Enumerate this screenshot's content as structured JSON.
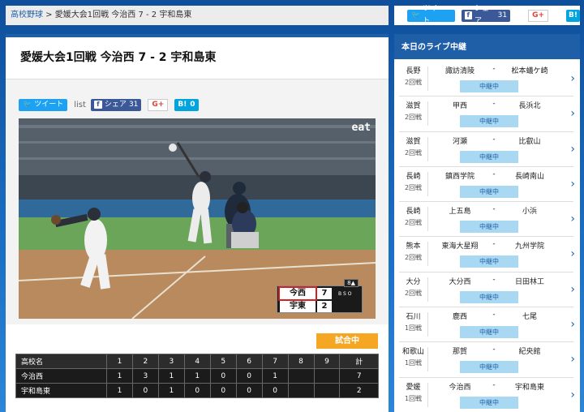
{
  "breadcrumb": {
    "parent": "高校野球",
    "separator": " > ",
    "current": "愛媛大会1回戦 今治西 7 - 2 宇和島東"
  },
  "article": {
    "title": "愛媛大会1回戦 今治西 7 - 2 宇和島東"
  },
  "share": {
    "tweet_label": "ツイート",
    "list_label": "list",
    "fb_label": "シェア",
    "fb_count": "31",
    "gplus_label": "G+",
    "hatena_label": "B!",
    "hatena_count": "0"
  },
  "video": {
    "broadcaster": "eat",
    "scoreboard": {
      "inning": "8▲",
      "home_team": "今西",
      "home_score": "7",
      "away_team": "宇東",
      "away_score": "2",
      "bso": "B S O"
    }
  },
  "status_badge": "試合中",
  "linescore": {
    "header": [
      "高校名",
      "1",
      "2",
      "3",
      "4",
      "5",
      "6",
      "7",
      "8",
      "9",
      "計"
    ],
    "rows": [
      {
        "team": "今治西",
        "innings": [
          "1",
          "3",
          "1",
          "1",
          "0",
          "0",
          "1",
          "",
          ""
        ],
        "total": "7"
      },
      {
        "team": "宇和島東",
        "innings": [
          "1",
          "0",
          "1",
          "0",
          "0",
          "0",
          "0",
          "",
          ""
        ],
        "total": "2"
      }
    ]
  },
  "sidebar": {
    "share": {
      "tweet_label": "ツイート",
      "fb_label": "シェア",
      "fb_count": "31",
      "gplus_label": "G+",
      "hatena_label": "B!"
    },
    "title": "本日のライブ中継",
    "games": [
      {
        "region": "長野",
        "round": "2回戦",
        "home": "諏訪清陵",
        "sep": "-",
        "away": "松本蟻ケ崎",
        "status": "中継中"
      },
      {
        "region": "滋賀",
        "round": "2回戦",
        "home": "甲西",
        "sep": "-",
        "away": "長浜北",
        "status": "中継中"
      },
      {
        "region": "滋賀",
        "round": "2回戦",
        "home": "河瀬",
        "sep": "-",
        "away": "比叡山",
        "status": "中継中"
      },
      {
        "region": "長崎",
        "round": "2回戦",
        "home": "鎮西学院",
        "sep": "-",
        "away": "長崎南山",
        "status": "中継中"
      },
      {
        "region": "長崎",
        "round": "2回戦",
        "home": "上五島",
        "sep": "-",
        "away": "小浜",
        "status": "中継中"
      },
      {
        "region": "熊本",
        "round": "2回戦",
        "home": "東海大星翔",
        "sep": "-",
        "away": "九州学院",
        "status": "中継中"
      },
      {
        "region": "大分",
        "round": "2回戦",
        "home": "大分西",
        "sep": "-",
        "away": "日田林工",
        "status": "中継中"
      },
      {
        "region": "石川",
        "round": "1回戦",
        "home": "鹿西",
        "sep": "-",
        "away": "七尾",
        "status": "中継中"
      },
      {
        "region": "和歌山",
        "round": "1回戦",
        "home": "那賀",
        "sep": "-",
        "away": "紀央館",
        "status": "中継中"
      },
      {
        "region": "愛媛",
        "round": "1回戦",
        "home": "今治西",
        "sep": "-",
        "away": "宇和島東",
        "status": "中継中"
      }
    ]
  },
  "colors": {
    "brand": "#1f5fa8",
    "status_live": "#a9d9f2",
    "badge": "#f5a623",
    "twitter": "#1da1f2",
    "facebook": "#3b5998"
  }
}
